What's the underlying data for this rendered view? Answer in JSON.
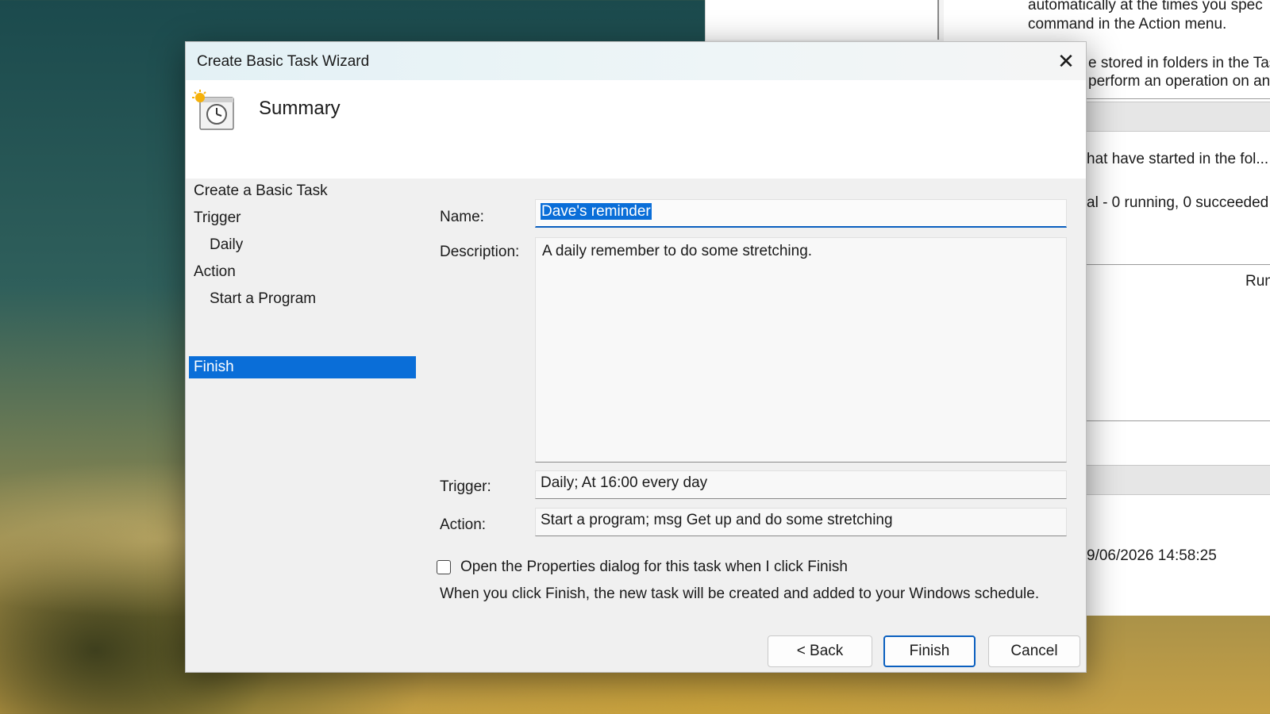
{
  "background_window": {
    "lines": [
      "automatically at the times you spec",
      "command in the Action menu.",
      "e stored in folders in the Tas",
      "perform an operation on an",
      "hat have started in the fol...",
      "al - 0 running, 0 succeeded,",
      "Run",
      "9/06/2026 14:58:25"
    ]
  },
  "dialog": {
    "title": "Create Basic Task Wizard",
    "close_icon": "close-icon",
    "header": {
      "icon": "task-clock-icon",
      "title": "Summary"
    },
    "steps": [
      {
        "label": "Create a Basic Task",
        "sub": false,
        "active": false
      },
      {
        "label": "Trigger",
        "sub": false,
        "active": false
      },
      {
        "label": "Daily",
        "sub": true,
        "active": false
      },
      {
        "label": "Action",
        "sub": false,
        "active": false
      },
      {
        "label": "Start a Program",
        "sub": true,
        "active": false
      },
      {
        "label": "Finish",
        "sub": false,
        "active": true
      }
    ],
    "form": {
      "name_label": "Name:",
      "name_value": "Dave's reminder",
      "description_label": "Description:",
      "description_value": "A daily remember to do some stretching.",
      "trigger_label": "Trigger:",
      "trigger_value": "Daily; At 16:00 every day",
      "action_label": "Action:",
      "action_value": "Start a program; msg Get up and do some stretching",
      "checkbox_label": "Open the Properties dialog for this task when I click Finish",
      "checkbox_checked": false,
      "note": "When you click Finish, the new task will be created and added to your Windows schedule."
    },
    "buttons": {
      "back": "< Back",
      "finish": "Finish",
      "cancel": "Cancel"
    },
    "colors": {
      "accent": "#0a6ed8",
      "selection": "#0a6ed8"
    }
  }
}
